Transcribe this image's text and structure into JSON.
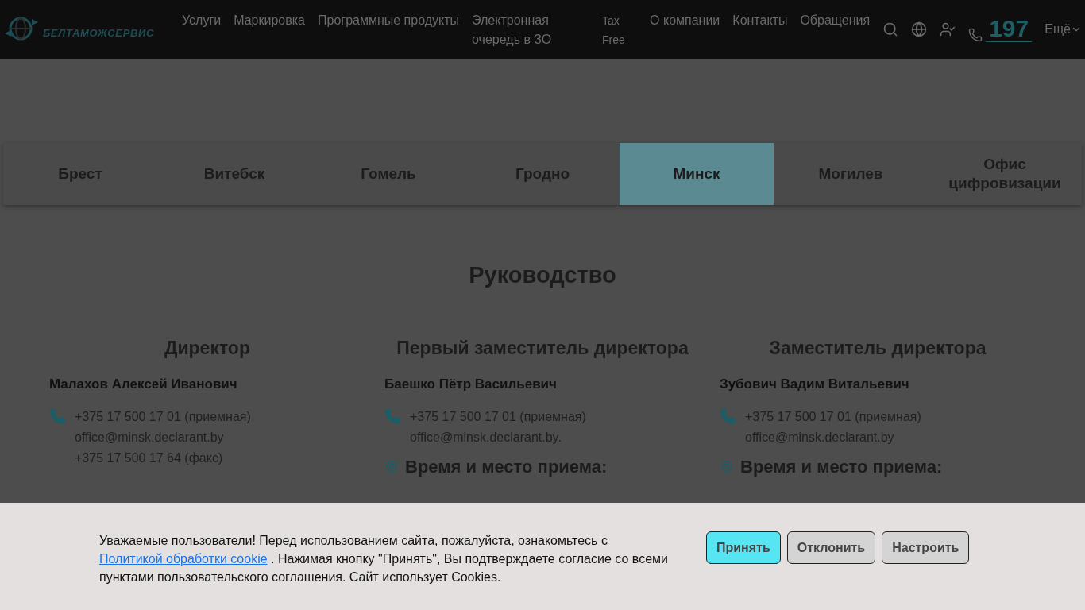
{
  "header": {
    "logo_text": "БЕЛТАМОЖСЕРВИС",
    "nav": [
      {
        "label": "Услуги",
        "kind": "regular"
      },
      {
        "label": "Маркировка",
        "kind": "regular"
      },
      {
        "label": "Программные продукты",
        "kind": "regular"
      },
      {
        "label": "Электронная очередь в ЗО",
        "kind": "wrapped"
      },
      {
        "label": "Tax Free",
        "kind": "compact"
      },
      {
        "label": "О компании",
        "kind": "regular"
      },
      {
        "label": "Контакты",
        "kind": "regular"
      },
      {
        "label": "Обращения",
        "kind": "regular"
      }
    ],
    "hotline": "197",
    "more": "Ещё"
  },
  "tabs": [
    {
      "label": "Брест",
      "selected": false
    },
    {
      "label": "Витебск",
      "selected": false
    },
    {
      "label": "Гомель",
      "selected": false
    },
    {
      "label": "Гродно",
      "selected": false
    },
    {
      "label": "Минск",
      "selected": true
    },
    {
      "label": "Могилев",
      "selected": false
    },
    {
      "label": "Офис цифровизации",
      "selected": false
    }
  ],
  "section_title": "Руководство",
  "columns": [
    {
      "role": "Директор",
      "name": "Малахов Алексей Иванович",
      "contacts": [
        "+375 17 500 17 01 (приемная)",
        "office@minsk.declarant.by",
        "+375 17 500 17 64 (факс)"
      ]
    },
    {
      "role": "Первый заместитель директора",
      "name": "Баешко Пётр Васильевич",
      "contacts": [
        "+375 17 500 17 01 (приемная)",
        "office@minsk.declarant.by."
      ],
      "reception_title": "Время и место приема:"
    },
    {
      "role": "Заместитель директора",
      "name": "Зубович Вадим Витальевич",
      "contacts": [
        "+375 17 500 17 01 (приемная)",
        "office@minsk.declarant.by"
      ],
      "reception_title": "Время и место приема:"
    }
  ],
  "cookie": {
    "text_before": "Уважаемые пользователи! Перед использованием сайта, пожалуйста, ознакомьтесь с",
    "link": "Политикой обработки cookie",
    "text_after": ". Нажимая кнопку \"Принять\", Вы подтверждаете согласие со всеми пунктами пользовательского соглашения. Сайт использует Cookies.",
    "buttons": [
      {
        "label": "Принять",
        "kind": "primary"
      },
      {
        "label": "Отклонить",
        "kind": "secondary"
      },
      {
        "label": "Настроить",
        "kind": "secondary"
      }
    ]
  }
}
